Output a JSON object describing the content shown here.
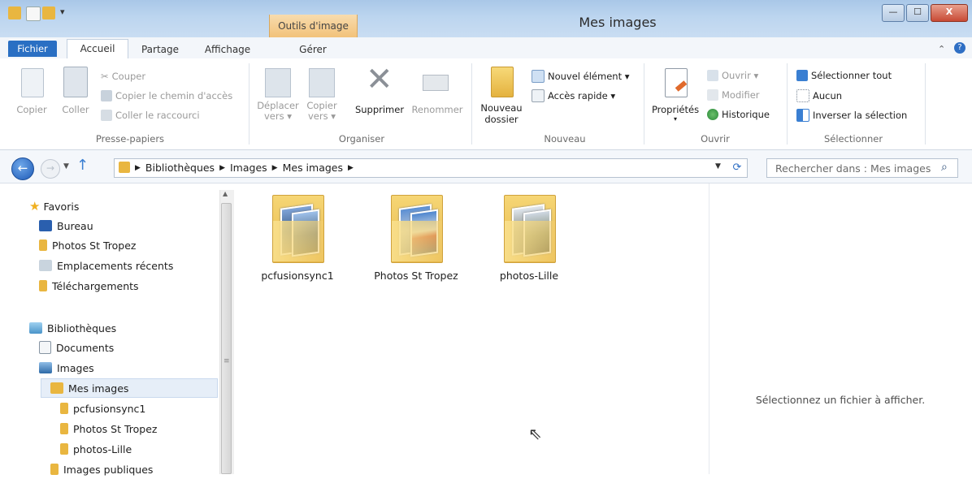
{
  "window": {
    "title": "Mes images",
    "context_tab": "Outils d'image",
    "controls": {
      "minimize": "—",
      "maximize": "☐",
      "close": "X"
    }
  },
  "tabs": [
    {
      "label": "Fichier"
    },
    {
      "label": "Accueil"
    },
    {
      "label": "Partage"
    },
    {
      "label": "Affichage"
    },
    {
      "label": "Gérer"
    }
  ],
  "ribbon": {
    "presse_papiers": {
      "label": "Presse-papiers",
      "copier": "Copier",
      "coller": "Coller",
      "couper": "Couper",
      "copier_chemin": "Copier le chemin d'accès",
      "coller_raccourci": "Coller le raccourci"
    },
    "organiser": {
      "label": "Organiser",
      "deplacer": "Déplacer",
      "deplacer2": "vers ▾",
      "copier": "Copier",
      "copier2": "vers ▾",
      "supprimer": "Supprimer",
      "renommer": "Renommer"
    },
    "nouveau": {
      "label": "Nouveau",
      "nouveau_dossier": "Nouveau",
      "nouveau_dossier2": "dossier",
      "nouvel_element": "Nouvel élément ▾",
      "acces_rapide": "Accès rapide ▾"
    },
    "ouvrir": {
      "label": "Ouvrir",
      "proprietes": "Propriétés",
      "ouvrir": "Ouvrir ▾",
      "modifier": "Modifier",
      "historique": "Historique"
    },
    "selectionner": {
      "label": "Sélectionner",
      "tout": "Sélectionner tout",
      "aucun": "Aucun",
      "inverser": "Inverser la sélection"
    }
  },
  "address": {
    "crumbs": [
      "Bibliothèques",
      "Images",
      "Mes images"
    ],
    "search_placeholder": "Rechercher dans : Mes images"
  },
  "nav": {
    "favoris": "Favoris",
    "bureau": "Bureau",
    "photos_st_tropez": "Photos St Tropez",
    "emplacements": "Emplacements récents",
    "telechargements": "Téléchargements",
    "bibliotheques": "Bibliothèques",
    "documents": "Documents",
    "images": "Images",
    "mes_images": "Mes images",
    "pcfusionsync1": "pcfusionsync1",
    "st_tropez_sub": "Photos St Tropez",
    "photos_lille": "photos-Lille",
    "images_publiques": "Images publiques"
  },
  "folders": [
    {
      "name": "pcfusionsync1"
    },
    {
      "name": "Photos St Tropez"
    },
    {
      "name": "photos-Lille"
    }
  ],
  "preview": {
    "message": "Sélectionnez un fichier à afficher."
  }
}
